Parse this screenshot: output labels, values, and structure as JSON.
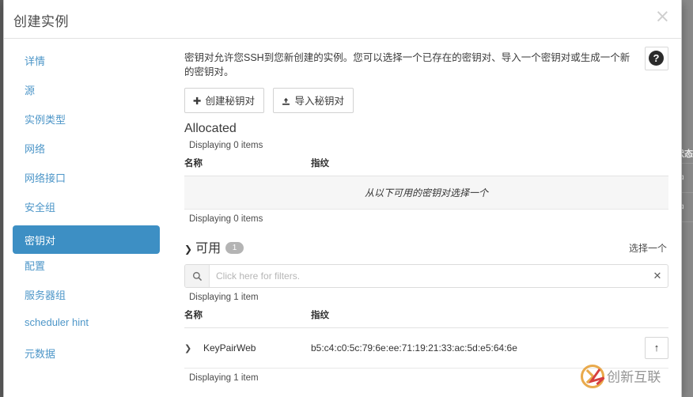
{
  "modal": {
    "title": "创建实例",
    "close_label": "×"
  },
  "sidebar": {
    "items": [
      {
        "label": "详情",
        "active": false
      },
      {
        "label": "源",
        "active": false
      },
      {
        "label": "实例类型",
        "active": false
      },
      {
        "label": "网络",
        "active": false
      },
      {
        "label": "网络接口",
        "active": false
      },
      {
        "label": "安全组",
        "active": false
      },
      {
        "label": "密钥对",
        "active": true
      },
      {
        "label": "配置",
        "active": false
      },
      {
        "label": "服务器组",
        "active": false
      },
      {
        "label": "scheduler hint",
        "active": false
      },
      {
        "label": "元数据",
        "active": false
      }
    ]
  },
  "content": {
    "intro": "密钥对允许您SSH到您新创建的实例。您可以选择一个已存在的密钥对、导入一个密钥对或生成一个新的密钥对。",
    "help_icon": "question-mark-icon",
    "buttons": [
      {
        "label": "创建秘钥对",
        "icon": "plus-icon"
      },
      {
        "label": "导入秘钥对",
        "icon": "upload-icon"
      }
    ],
    "allocated": {
      "title": "Allocated",
      "count_top": "Displaying 0 items",
      "count_bottom": "Displaying 0 items",
      "columns": [
        "名称",
        "指纹"
      ],
      "empty_message": "从以下可用的密钥对选择一个"
    },
    "available": {
      "label": "可用",
      "badge": "1",
      "caret": "⌄",
      "select_link": "选择一个",
      "filter_placeholder": "Click here for filters.",
      "filter_value": "",
      "filter_icon": "search-icon",
      "clear_icon": "clear-icon",
      "count_top": "Displaying 1 item",
      "count_bottom": "Displaying 1 item",
      "columns": [
        "名称",
        "指纹"
      ],
      "rows": [
        {
          "expand_icon": "chevron-right-icon",
          "name": "KeyPairWeb",
          "fingerprint": "b5:c4:c0:5c:79:6e:ee:71:19:21:33:ac:5d:e5:64:6e",
          "action_icon": "arrow-up-icon"
        }
      ]
    }
  },
  "background": {
    "column_header": "状态",
    "cells": [
      "中",
      "中"
    ]
  },
  "colors": {
    "accent": "#3d8fc4",
    "link": "#4d96c8",
    "badge": "#b4b4b4",
    "empty_row_bg": "#f6f6f6"
  }
}
